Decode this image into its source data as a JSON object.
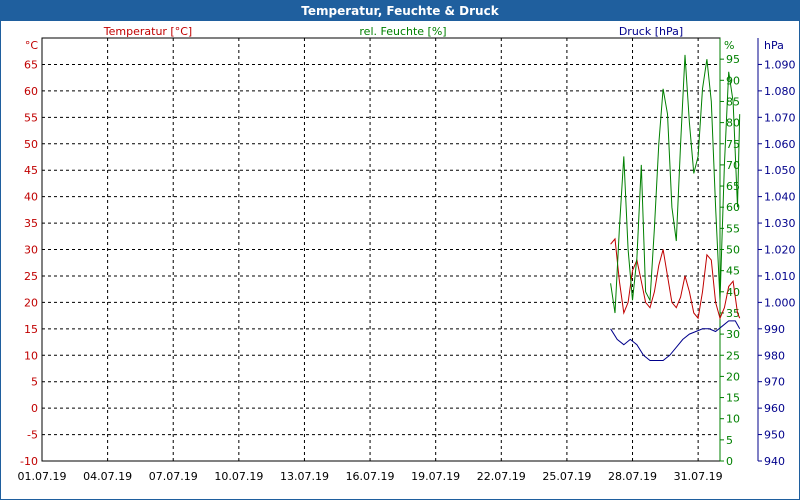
{
  "window": {
    "title": "Temperatur, Feuchte & Druck"
  },
  "colors": {
    "titlebar": "#1f5f9e",
    "temperature": "#c00000",
    "humidity": "#008000",
    "pressure": "#00008b",
    "grid": "#000000"
  },
  "chart_data": {
    "type": "line",
    "title": "Temperatur, Feuchte & Druck",
    "grid": true,
    "x_axis": {
      "range": [
        "01.07.19",
        "01.08.19"
      ],
      "ticks": [
        "01.07.19",
        "04.07.19",
        "07.07.19",
        "10.07.19",
        "13.07.19",
        "16.07.19",
        "19.07.19",
        "22.07.19",
        "25.07.19",
        "28.07.19",
        "31.07.19"
      ],
      "tick_days": [
        0,
        3,
        6,
        9,
        12,
        15,
        18,
        21,
        24,
        27,
        30
      ]
    },
    "axes": {
      "temperature": {
        "unit_label": "°C",
        "ylim": [
          -10,
          70
        ],
        "ticks": [
          "70",
          "65",
          "60",
          "55",
          "50",
          "45",
          "40",
          "35",
          "30",
          "25",
          "20",
          "15",
          "10",
          "5",
          "0",
          "-5",
          "-10"
        ]
      },
      "humidity": {
        "unit_label": "%",
        "ylim": [
          0,
          100
        ],
        "ticks": [
          "95",
          "90",
          "85",
          "80",
          "75",
          "70",
          "65",
          "60",
          "55",
          "50",
          "45",
          "40",
          "35",
          "30",
          "25",
          "20",
          "15",
          "10",
          "5",
          "0"
        ]
      },
      "pressure": {
        "unit_label": "hPa",
        "ylim": [
          940,
          1100
        ],
        "ticks": [
          "1.090",
          "1.080",
          "1.070",
          "1.060",
          "1.050",
          "1.040",
          "1.030",
          "1.020",
          "1.010",
          "1.000",
          "990",
          "980",
          "970",
          "960",
          "950",
          "940"
        ]
      }
    },
    "series": [
      {
        "name": "Temperatur [°C]",
        "axis": "temperature",
        "color": "#c00000",
        "x": [
          26.0,
          26.2,
          26.4,
          26.6,
          26.8,
          27.0,
          27.2,
          27.4,
          27.6,
          27.8,
          28.0,
          28.2,
          28.4,
          28.6,
          28.8,
          29.0,
          29.2,
          29.4,
          29.6,
          29.8,
          30.0,
          30.2,
          30.4,
          30.6,
          30.8,
          31.0,
          31.2,
          31.4,
          31.6,
          31.8,
          31.9
        ],
        "y": [
          31,
          32,
          24,
          18,
          20,
          26,
          28,
          24,
          20,
          19,
          22,
          27,
          30,
          25,
          20,
          19,
          21,
          25,
          22,
          18,
          17,
          22,
          29,
          28,
          20,
          17,
          19,
          23,
          24,
          18,
          17
        ]
      },
      {
        "name": "rel. Feuchte [%]",
        "axis": "humidity",
        "color": "#008000",
        "x": [
          26.0,
          26.2,
          26.4,
          26.6,
          26.8,
          27.0,
          27.2,
          27.4,
          27.6,
          27.8,
          28.0,
          28.2,
          28.4,
          28.6,
          28.8,
          29.0,
          29.2,
          29.4,
          29.6,
          29.8,
          30.0,
          30.2,
          30.4,
          30.6,
          30.8,
          31.0,
          31.2,
          31.4,
          31.6,
          31.8,
          31.9
        ],
        "y": [
          42,
          35,
          55,
          72,
          50,
          38,
          48,
          70,
          40,
          38,
          55,
          75,
          88,
          82,
          60,
          52,
          75,
          96,
          80,
          68,
          72,
          88,
          95,
          85,
          60,
          38,
          70,
          92,
          85,
          60,
          82
        ]
      },
      {
        "name": "Druck [hPa]",
        "axis": "pressure",
        "color": "#00008b",
        "x": [
          26.0,
          26.3,
          26.6,
          26.9,
          27.2,
          27.5,
          27.8,
          28.1,
          28.4,
          28.7,
          29.0,
          29.3,
          29.6,
          29.9,
          30.2,
          30.5,
          30.8,
          31.1,
          31.4,
          31.7,
          31.9
        ],
        "y": [
          990,
          986,
          984,
          986,
          984,
          980,
          978,
          978,
          978,
          980,
          983,
          986,
          988,
          989,
          990,
          990,
          989,
          991,
          993,
          993,
          990
        ]
      }
    ]
  }
}
